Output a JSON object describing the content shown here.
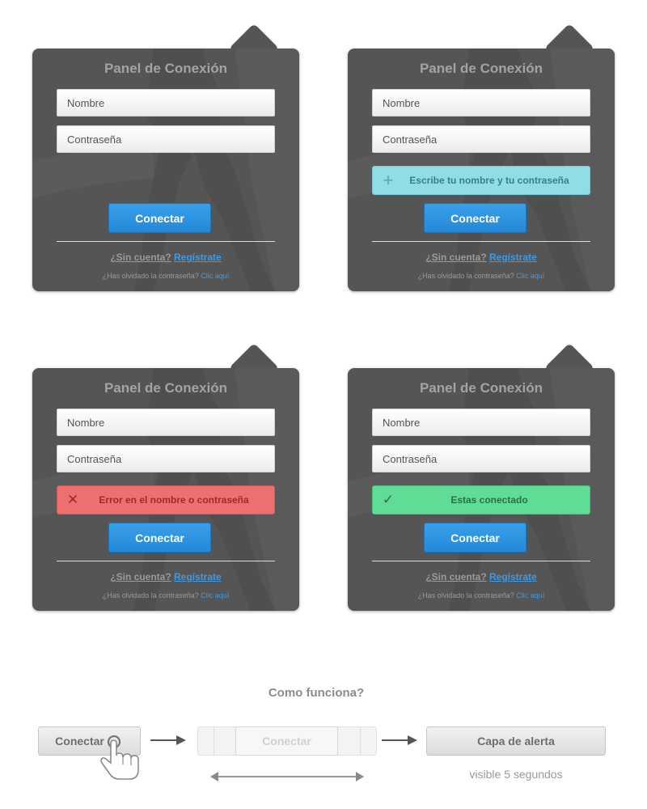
{
  "panels": [
    {
      "title": "Panel de Conexión",
      "name_placeholder": "Nombre",
      "password_placeholder": "Contraseña",
      "alert": null,
      "connect_label": "Conectar",
      "no_account_question": "¿Sin cuenta?",
      "register_link": "Regístrate",
      "forgot_question": "¿Has olvidado la contraseña?",
      "forgot_link": "Clic aquí"
    },
    {
      "title": "Panel de Conexión",
      "name_placeholder": "Nombre",
      "password_placeholder": "Contraseña",
      "alert": {
        "type": "info",
        "icon": "plus-icon",
        "text": "Escribe tu nombre y tu contraseña"
      },
      "connect_label": "Conectar",
      "no_account_question": "¿Sin cuenta?",
      "register_link": "Regístrate",
      "forgot_question": "¿Has olvidado la contraseña?",
      "forgot_link": "Clic aquí"
    },
    {
      "title": "Panel de Conexión",
      "name_placeholder": "Nombre",
      "password_placeholder": "Contraseña",
      "alert": {
        "type": "error",
        "icon": "close-icon",
        "text": "Error en el nombre o contraseña"
      },
      "connect_label": "Conectar",
      "no_account_question": "¿Sin cuenta?",
      "register_link": "Regístrate",
      "forgot_question": "¿Has olvidado la contraseña?",
      "forgot_link": "Clic aquí"
    },
    {
      "title": "Panel de Conexión",
      "name_placeholder": "Nombre",
      "password_placeholder": "Contraseña",
      "alert": {
        "type": "success",
        "icon": "check-icon",
        "text": "Estas conectado"
      },
      "connect_label": "Conectar",
      "no_account_question": "¿Sin cuenta?",
      "register_link": "Regístrate",
      "forgot_question": "¿Has olvidado la contraseña?",
      "forgot_link": "Clic aquí"
    }
  ],
  "how_it_works": {
    "title": "Como funciona?",
    "step1_label": "Conectar",
    "step2_label": "Conectar",
    "step3_label": "Capa de alerta",
    "step3_caption": "visible 5 segundos",
    "icons": [
      "hand-pointer-icon",
      "arrow-right-icon",
      "double-arrow-icon"
    ]
  },
  "colors": {
    "panel_bg": "#555555",
    "connect_button": "#2a8fdd",
    "link": "#3d9ae4",
    "info_alert": "#8fdde6",
    "error_alert": "#ec7070",
    "success_alert": "#5fdc96"
  }
}
